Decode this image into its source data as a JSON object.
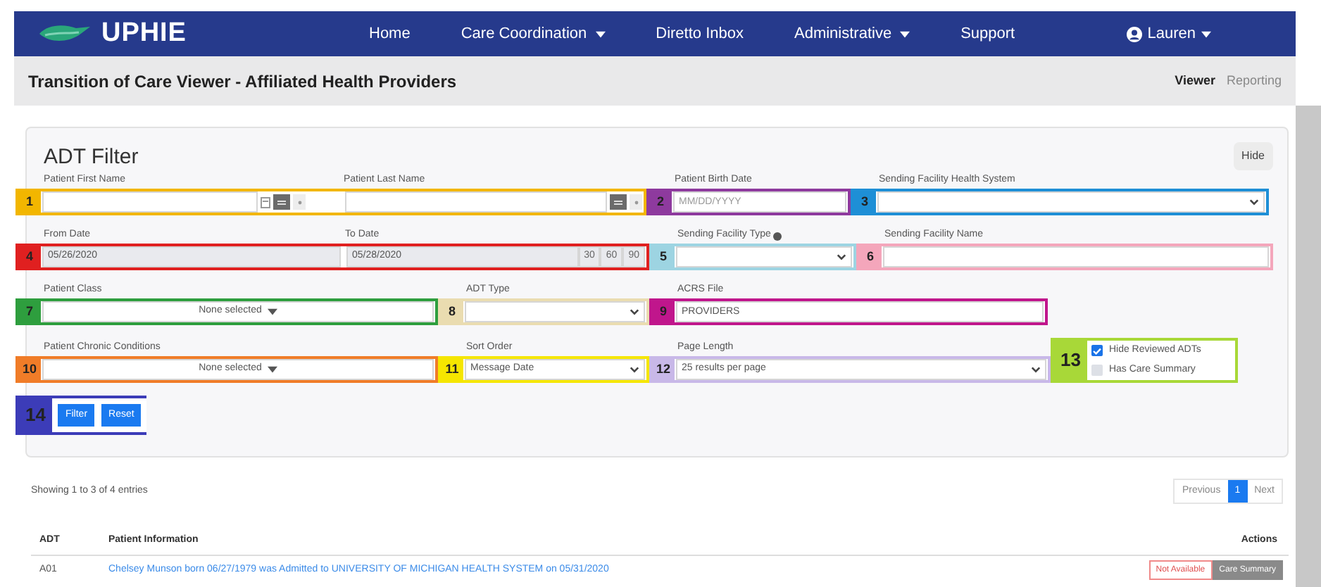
{
  "nav": {
    "brand": "UPHIE",
    "items": [
      {
        "label": "Home",
        "dropdown": false
      },
      {
        "label": "Care Coordination",
        "dropdown": true
      },
      {
        "label": "Diretto Inbox",
        "dropdown": false
      },
      {
        "label": "Administrative",
        "dropdown": true
      },
      {
        "label": "Support",
        "dropdown": false
      }
    ],
    "user": {
      "label": "Lauren",
      "dropdown": true
    }
  },
  "page_header": {
    "title": "Transition of Care Viewer - Affiliated Health Providers",
    "tabs": [
      {
        "label": "Viewer",
        "selected": true
      },
      {
        "label": "Reporting",
        "selected": false
      }
    ]
  },
  "filter": {
    "title": "ADT Filter",
    "hide_button": "Hide",
    "rows": [
      {
        "callouts": [
          {
            "number": "1",
            "color": "#f2b600",
            "fields": [
              {
                "kind": "name",
                "label": "Patient First Name",
                "calendar": true
              },
              {
                "kind": "name",
                "label": "Patient Last Name",
                "calendar": false
              }
            ]
          },
          {
            "number": "2",
            "color": "#8e3a9e",
            "fields": [
              {
                "kind": "text",
                "label": "Patient Birth Date",
                "placeholder": "MM/DD/YYYY"
              }
            ]
          },
          {
            "number": "3",
            "color": "#1e8fd6",
            "fields": [
              {
                "kind": "select",
                "label": "Sending Facility Health System"
              }
            ]
          }
        ]
      },
      {
        "callouts": [
          {
            "number": "4",
            "color": "#e02020",
            "fields": [
              {
                "kind": "date",
                "label": "From Date",
                "value": "05/26/2020"
              },
              {
                "kind": "date",
                "label": "To Date",
                "value": "05/28/2020",
                "quick": [
                  "30",
                  "60",
                  "90"
                ]
              }
            ]
          },
          {
            "number": "5",
            "color": "#9dd4e2",
            "fields": [
              {
                "kind": "select",
                "label": "Sending Facility Type",
                "info": true
              }
            ]
          },
          {
            "number": "6",
            "color": "#f4a6bb",
            "fields": [
              {
                "kind": "text",
                "label": "Sending Facility Name"
              }
            ]
          }
        ]
      },
      {
        "callouts": [
          {
            "number": "7",
            "color": "#2e9e3e",
            "fields": [
              {
                "kind": "multiselect",
                "label": "Patient Class",
                "value": "None selected"
              }
            ]
          },
          {
            "number": "8",
            "color": "#eadcb0",
            "fields": [
              {
                "kind": "select",
                "label": "ADT Type"
              }
            ]
          },
          {
            "number": "9",
            "color": "#c0168c",
            "fields": [
              {
                "kind": "text",
                "label": "ACRS File",
                "value": "PROVIDERS"
              }
            ]
          }
        ]
      },
      {
        "callouts": [
          {
            "number": "10",
            "color": "#f07c28",
            "fields": [
              {
                "kind": "multiselect",
                "label": "Patient Chronic Conditions",
                "value": "None selected"
              }
            ]
          },
          {
            "number": "11",
            "color": "#f5e600",
            "fields": [
              {
                "kind": "select",
                "label": "Sort Order",
                "value": "Message Date"
              }
            ]
          },
          {
            "number": "12",
            "color": "#c8b8e8",
            "fields": [
              {
                "kind": "select",
                "label": "Page Length",
                "value": "25 results per page"
              }
            ]
          },
          {
            "number": "13",
            "color": "#a8d838",
            "fields": [
              {
                "kind": "checkboxes",
                "options": [
                  {
                    "label": "Hide Reviewed ADTs",
                    "checked": true
                  },
                  {
                    "label": "Has Care Summary",
                    "checked": false
                  }
                ]
              }
            ]
          }
        ]
      },
      {
        "callouts": [
          {
            "number": "14",
            "color": "#3c3cb8",
            "fields": [
              {
                "kind": "buttons",
                "buttons": [
                  "Filter",
                  "Reset"
                ]
              }
            ]
          }
        ]
      }
    ]
  },
  "results": {
    "summary": "Showing 1 to 3 of 4 entries",
    "pagination": [
      {
        "label": "Previous",
        "selected": false
      },
      {
        "label": "1",
        "selected": true
      },
      {
        "label": "Next",
        "selected": false
      }
    ],
    "table": {
      "columns": [
        "ADT",
        "Patient Information",
        "Actions"
      ],
      "rows": [
        {
          "adt": "A01",
          "info": "Chelsey Munson born 06/27/1979 was Admitted to UNIVERSITY OF MICHIGAN HEALTH SYSTEM on 05/31/2020",
          "actions": [
            {
              "label": "Not Available",
              "kind": "outline"
            },
            {
              "label": "Care Summary",
              "kind": "solid"
            }
          ]
        }
      ]
    }
  }
}
